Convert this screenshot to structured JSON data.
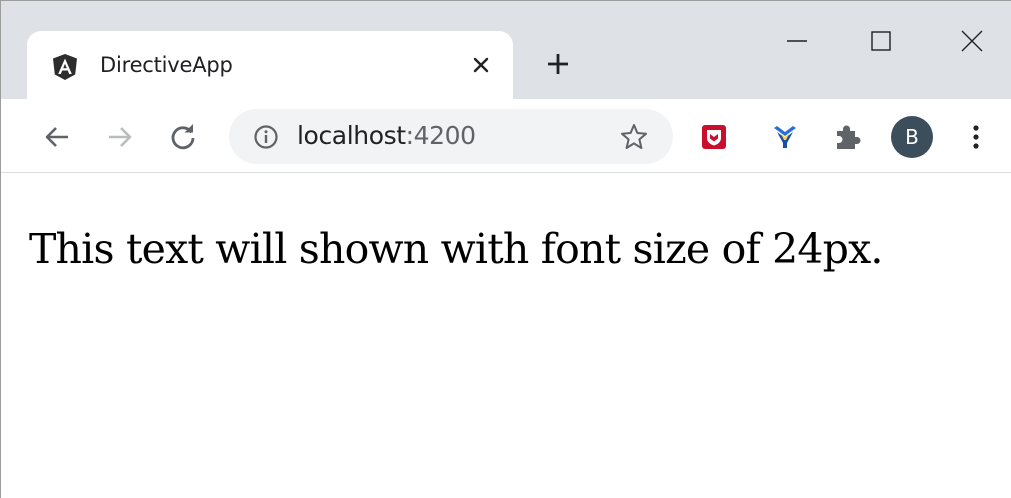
{
  "tab": {
    "title": "DirectiveApp",
    "favicon": "angular-icon"
  },
  "address_bar": {
    "host": "localhost",
    "port": ":4200"
  },
  "toolbar": {
    "avatar_initial": "B"
  },
  "page": {
    "text": "This text will shown with font size of 24px."
  },
  "colors": {
    "tabstrip_bg": "#dee1e6",
    "omnibox_bg": "#f1f3f4",
    "avatar_bg": "#3c4e5c",
    "mcafee_red": "#c8102e",
    "yslow_blue": "#2a6fd6"
  }
}
